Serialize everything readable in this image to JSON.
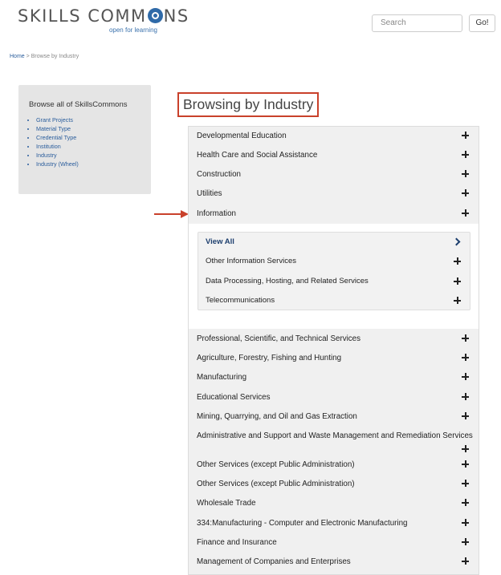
{
  "logo": {
    "text_before": "SKILLS COMM",
    "text_after": "NS",
    "tagline": "open for learning"
  },
  "search": {
    "placeholder": "Search",
    "button": "Go!"
  },
  "breadcrumb": {
    "home": "Home",
    "separator": ">",
    "current": "Browse by Industry"
  },
  "sidebar": {
    "title": "Browse all of SkillsCommons",
    "items": [
      "Grant Projects",
      "Material Type",
      "Credential Type",
      "Institution",
      "Industry",
      "Industry (Wheel)"
    ]
  },
  "page_title": "Browsing by Industry",
  "accent_color": "#c9412b",
  "industries_top": [
    "Developmental Education",
    "Health Care and Social Assistance",
    "Construction",
    "Utilities",
    "Information"
  ],
  "information_sub": {
    "view_all": "View All",
    "items": [
      "Other Information Services",
      "Data Processing, Hosting, and Related Services",
      "Telecommunications"
    ]
  },
  "industries_bottom": [
    "Professional, Scientific, and Technical Services",
    "Agriculture, Forestry, Fishing and Hunting",
    "Manufacturing",
    "Educational Services",
    "Mining, Quarrying, and Oil and Gas Extraction",
    "Administrative and Support and Waste Management and Remediation Services",
    "Other Services (except Public Administration)",
    "Other Services (except Public Administration)",
    "Wholesale Trade",
    "334:Manufacturing - Computer and Electronic Manufacturing",
    "Finance and Insurance",
    "Management of Companies and Enterprises"
  ]
}
